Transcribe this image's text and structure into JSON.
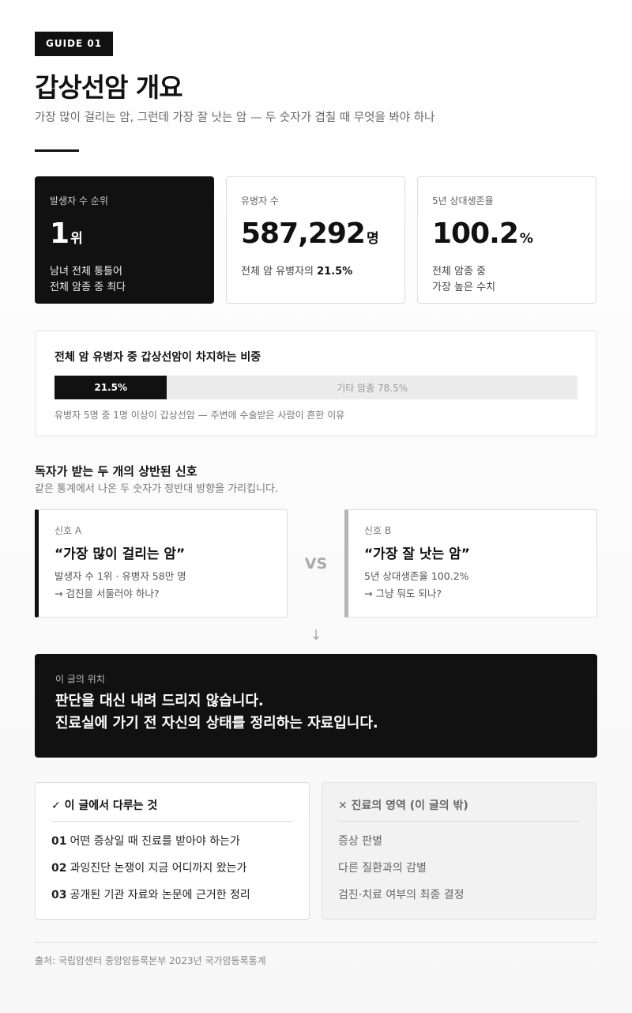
{
  "header": {
    "badge": "GUIDE 01",
    "title": "갑상선암 개요",
    "subtitle": "가장 많이 걸리는 암, 그런데 가장 잘 낫는 암 — 두 숫자가 겹칠 때 무엇을 봐야 하나"
  },
  "stats": [
    {
      "label": "발생자 수 순위",
      "value": "1",
      "unit": "위",
      "desc1": "남녀 전체 통틀어",
      "desc2": "전체 암종 중 최다"
    },
    {
      "label": "유병자 수",
      "value": "587,292",
      "unit": "명",
      "desc_prefix": "전체 암 유병자의 ",
      "desc_bold": "21.5%"
    },
    {
      "label": "5년 상대생존율",
      "value": "100.2",
      "unit": "%",
      "desc1": "전체 암종 중",
      "desc2": "가장 높은 수치"
    }
  ],
  "share": {
    "title": "전체 암 유병자 중 갑상선암이 차지하는 비중",
    "fill_label": "21.5%",
    "fill_percent": 21.5,
    "rest_label": "기타 암종 78.5%",
    "note": "유병자 5명 중 1명 이상이 갑상선암 — 주변에 수술받은 사람이 흔한 이유"
  },
  "signals": {
    "title": "독자가 받는 두 개의 상반된 신호",
    "subtitle": "같은 통계에서 나온 두 숫자가 정반대 방향을 가리킵니다.",
    "vs": "VS",
    "a": {
      "tag": "신호 A",
      "quote": "“가장 많이 걸리는 암”",
      "line1": "발생자 수 1위 · 유병자 58만 명",
      "line2": "→ 검진을 서둘러야 하나?"
    },
    "b": {
      "tag": "신호 B",
      "quote": "“가장 잘 낫는 암”",
      "line1": "5년 상대생존율 100.2%",
      "line2": "→ 그냥 둬도 되나?"
    }
  },
  "arrow": "↓",
  "position": {
    "label": "이 글의 위치",
    "line1": "판단을 대신 내려 드리지 않습니다.",
    "line2": "진료실에 가기 전 자신의 상태를 정리하는 자료입니다."
  },
  "scope": {
    "in": {
      "head": "✓ 이 글에서 다루는 것",
      "items": [
        {
          "num": "01",
          "text": "어떤 증상일 때 진료를 받아야 하는가"
        },
        {
          "num": "02",
          "text": "과잉진단 논쟁이 지금 어디까지 왔는가"
        },
        {
          "num": "03",
          "text": "공개된 기관 자료와 논문에 근거한 정리"
        }
      ]
    },
    "out": {
      "head": "✕ 진료의 영역 (이 글의 밖)",
      "items": [
        "증상 판별",
        "다른 질환과의 감별",
        "검진·치료 여부의 최종 결정"
      ]
    }
  },
  "footer": {
    "source": "출처: 국립암센터 중앙암등록본부 2023년 국가암등록통계"
  }
}
